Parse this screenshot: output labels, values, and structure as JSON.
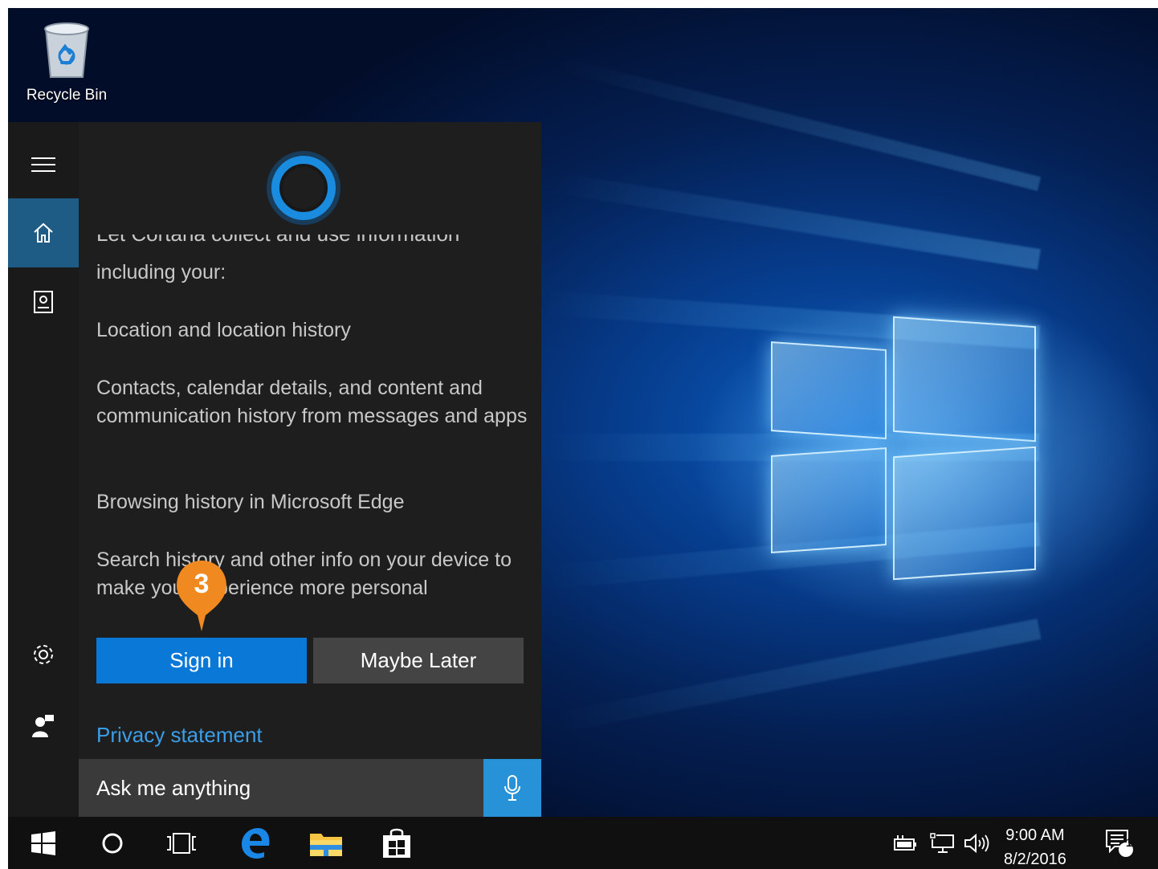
{
  "desktop": {
    "recycle_bin_label": "Recycle Bin"
  },
  "cortana": {
    "cut_off_text": "Let Cortana collect and use information",
    "intro": "including your:",
    "items": [
      "Location and location history",
      "Contacts, calendar details, and content and communication history from messages and apps",
      "Browsing history in Microsoft Edge",
      "Search history and other info on your device to make your experience more personal"
    ],
    "signin_label": "Sign in",
    "later_label": "Maybe Later",
    "privacy_label": "Privacy statement",
    "search_placeholder": "Ask me anything"
  },
  "callout": {
    "number": "3",
    "color": "#f0891f"
  },
  "taskbar": {
    "time": "9:00 AM",
    "date": "8/2/2016",
    "notification_count": "1"
  },
  "colors": {
    "accent": "#0a78d7",
    "link": "#3a9ee8",
    "rail_active": "#1f5c85"
  },
  "icons": [
    "recycle-bin-icon",
    "hamburger-icon",
    "home-icon",
    "notebook-icon",
    "settings-icon",
    "feedback-icon",
    "microphone-icon",
    "start-icon",
    "search-icon",
    "task-view-icon",
    "edge-icon",
    "file-explorer-icon",
    "store-icon",
    "battery-icon",
    "network-icon",
    "volume-icon",
    "action-center-icon"
  ]
}
